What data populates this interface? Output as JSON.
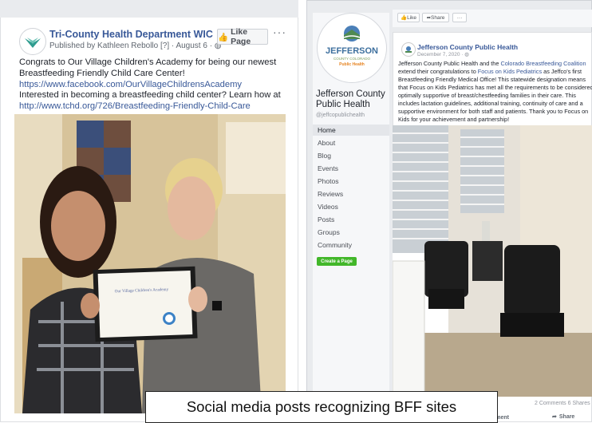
{
  "left_post": {
    "page_name": "Tri-County Health Department WIC",
    "published_by": "Published by Kathleen Rebollo [?] · August 6 · ",
    "like_page_label": "Like Page",
    "more_label": "···",
    "line1": "Congrats to Our Village Children's Academy for being our newest",
    "line2": "Breastfeeding Friendly Child Care Center!",
    "link1": "https://www.facebook.com/OurVillageChildrensAcademy",
    "line3": "Interested in becoming a breastfeeding child center? Learn how at",
    "link2": "http://www.tchd.org/726/Breastfeeding-Friendly-Child-Care",
    "certificate_title": "Our Village Children's Academy"
  },
  "right_page": {
    "toolbar_like": "Like",
    "toolbar_share": "Share",
    "toolbar_more": "···",
    "logo_word": "JEFFERSON",
    "logo_line2": "COUNTY COLORADO",
    "logo_line3": "Public Health",
    "page_name": "Jefferson County Public Health",
    "handle": "@jeffcopublichealth",
    "nav": [
      "Home",
      "About",
      "Blog",
      "Events",
      "Photos",
      "Reviews",
      "Videos",
      "Posts",
      "Groups",
      "Community"
    ],
    "create_page_label": "Create a Page",
    "post_author": "Jefferson County Public Health",
    "post_date": "December 7, 2020 · ",
    "text_l1_a": "Jefferson County Public Health and the ",
    "text_l1_link": "Colorado Breastfeeding Coalition",
    "text_l2_a": "extend their congratulations to ",
    "text_l2_link": "Focus on Kids Pediatrics",
    "text_l2_b": " as Jeffco's first",
    "text_l3": "Breastfeeding Friendly Medical Office! This statewide designation means",
    "text_l4": "that Focus on Kids Pediatrics has met all the requirements to be considered",
    "text_l5": "optimally supportive of breast/chestfeeding families in their care. This",
    "text_l6": "includes lactation guidelines, additional training, continuity of care and a",
    "text_l7": "supportive environment for both staff and patients. Thank you to Focus on",
    "text_l8": "Kids for your achievement and partnership!",
    "comments_shares": "2 Comments 6 Shares",
    "comment_label": "mment",
    "share_label": "Share"
  },
  "caption": "Social media posts recognizing BFF sites",
  "colors": {
    "link": "#385898",
    "green": "#42b72a",
    "fb_bg": "#e9ebee"
  }
}
